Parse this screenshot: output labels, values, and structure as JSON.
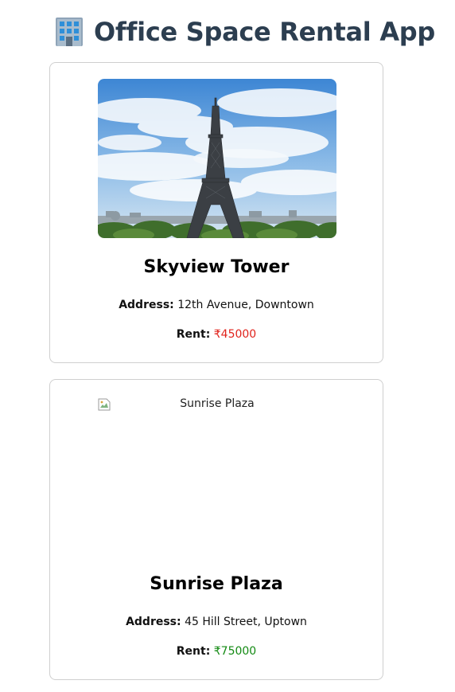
{
  "header": {
    "title": "Office Space Rental App",
    "icon": "office-building-icon"
  },
  "offices": [
    {
      "name": "Skyview Tower",
      "image_alt": "Skyview Tower",
      "image_loaded": true,
      "address_label": "Address:",
      "address": "12th Avenue, Downtown",
      "rent_label": "Rent:",
      "rent": "₹45000",
      "rent_color": "#e0221b"
    },
    {
      "name": "Sunrise Plaza",
      "image_alt": "Sunrise Plaza",
      "image_loaded": false,
      "address_label": "Address:",
      "address": "45 Hill Street, Uptown",
      "rent_label": "Rent:",
      "rent": "₹75000",
      "rent_color": "#138a13"
    }
  ]
}
